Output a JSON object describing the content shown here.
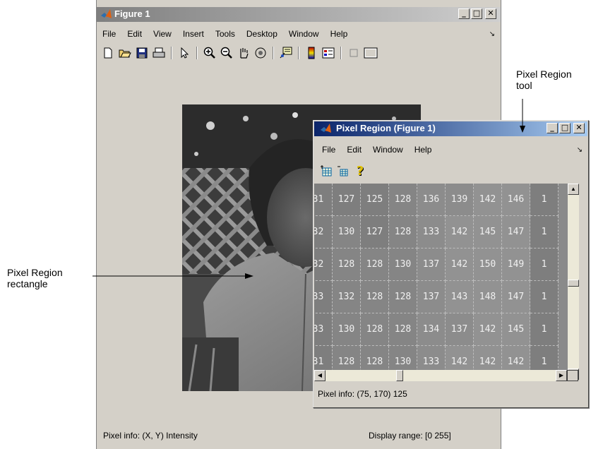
{
  "figure_window": {
    "title": "Figure 1",
    "menu": [
      "File",
      "Edit",
      "View",
      "Insert",
      "Tools",
      "Desktop",
      "Window",
      "Help"
    ],
    "menu_arrow": "↘",
    "toolbar_icons": [
      "new-figure-icon",
      "open-file-icon",
      "save-icon",
      "print-icon",
      "select-arrow-icon",
      "zoom-in-icon",
      "zoom-out-icon",
      "pan-hand-icon",
      "rotate-3d-icon",
      "data-cursor-icon",
      "colorbar-icon",
      "legend-icon",
      "hide-plot-tools-icon",
      "show-plot-tools-icon"
    ],
    "status_left": "Pixel info: (X, Y)  Intensity",
    "status_right": "Display range: [0 255]"
  },
  "pixel_region": {
    "title": "Pixel Region (Figure 1)",
    "menu": [
      "File",
      "Edit",
      "Window",
      "Help"
    ],
    "menu_arrow": "↘",
    "toolbar_icons": [
      "expand-region-icon",
      "shrink-region-icon",
      "help-icon"
    ],
    "help_glyph": "?",
    "grid_rows": [
      [
        "31",
        "127",
        "125",
        "128",
        "136",
        "139",
        "142",
        "146",
        "1"
      ],
      [
        "32",
        "130",
        "127",
        "128",
        "133",
        "142",
        "145",
        "147",
        "1"
      ],
      [
        "32",
        "128",
        "128",
        "130",
        "137",
        "142",
        "150",
        "149",
        "1"
      ],
      [
        "33",
        "132",
        "128",
        "128",
        "137",
        "143",
        "148",
        "147",
        "1"
      ],
      [
        "33",
        "130",
        "128",
        "128",
        "134",
        "137",
        "142",
        "145",
        "1"
      ],
      [
        "31",
        "128",
        "128",
        "130",
        "133",
        "142",
        "142",
        "142",
        "1"
      ]
    ],
    "pixel_info": "Pixel info: (75, 170)  125"
  },
  "callouts": {
    "tool_line1": "Pixel Region",
    "tool_line2": "tool",
    "rect_line1": "Pixel Region",
    "rect_line2": "rectangle"
  },
  "window_buttons": {
    "minimize": "_",
    "maximize": "□",
    "close": "✕"
  }
}
